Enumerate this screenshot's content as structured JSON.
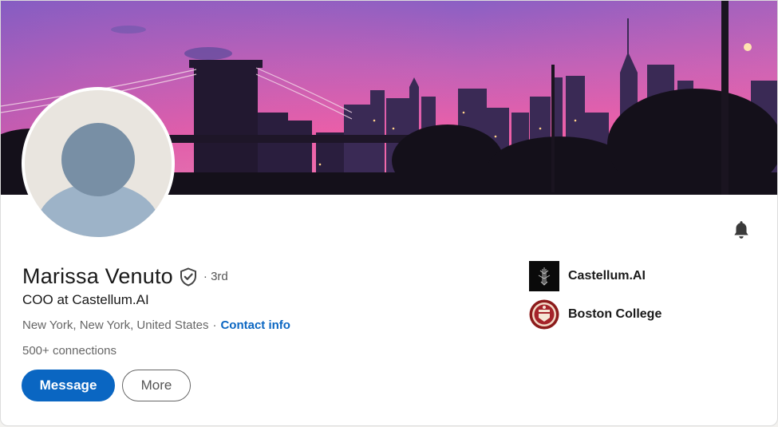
{
  "profile": {
    "name": "Marissa Venuto",
    "degree": "· 3rd",
    "headline": "COO at Castellum.AI",
    "location": "New York, New York, United States",
    "separator": "·",
    "contact_info": "Contact info",
    "connections": "500+ connections"
  },
  "actions": {
    "message_label": "Message",
    "more_label": "More"
  },
  "organizations": [
    {
      "label": "Castellum.AI",
      "icon": "castellum-logo-icon"
    },
    {
      "label": "Boston College",
      "icon": "boston-college-seal-icon"
    }
  ],
  "icons": {
    "verify": "shield-check-icon",
    "bell": "bell-icon"
  },
  "colors": {
    "accent": "#0a66c2",
    "text_primary": "#191919",
    "text_secondary": "#666666",
    "banner_sky_top": "#8a5fc4",
    "banner_sky_bottom": "#ef5fa7"
  }
}
